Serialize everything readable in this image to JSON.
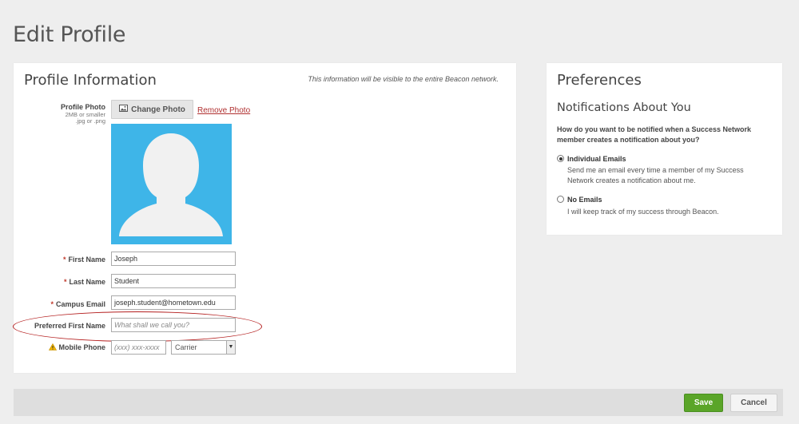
{
  "page": {
    "title": "Edit Profile"
  },
  "profile": {
    "heading": "Profile Information",
    "visibility_note": "This information will be visible to the entire Beacon network.",
    "photo": {
      "label": "Profile Photo",
      "hint_size": "2MB or smaller",
      "hint_type": ".jpg or .png",
      "change_label": "Change Photo",
      "remove_label": "Remove Photo"
    },
    "fields": {
      "first_name": {
        "label": "First Name",
        "value": "Joseph",
        "required": "*"
      },
      "last_name": {
        "label": "Last Name",
        "value": "Student",
        "required": "*"
      },
      "campus_email": {
        "label": "Campus Email",
        "value": "joseph.student@hometown.edu",
        "required": "*"
      },
      "preferred_first_name": {
        "label": "Preferred First Name",
        "placeholder": "What shall we call you?"
      },
      "mobile_phone": {
        "label": "Mobile Phone",
        "placeholder": "(xxx) xxx-xxxx",
        "carrier": "Carrier"
      }
    }
  },
  "preferences": {
    "heading": "Preferences",
    "subheading": "Notifications About You",
    "question": "How do you want to be notified when a Success Network member creates a notification about you?",
    "options": [
      {
        "title": "Individual Emails",
        "description": "Send me an email every time a member of my Success Network creates a notification about me.",
        "selected": true
      },
      {
        "title": "No Emails",
        "description": "I will keep track of my success through Beacon.",
        "selected": false
      }
    ]
  },
  "footer": {
    "save_label": "Save",
    "cancel_label": "Cancel"
  },
  "colors": {
    "accent_green": "#5aa528",
    "avatar_blue": "#3eb5e8",
    "required_red": "#c0392b",
    "highlight_red": "#b41e1e",
    "warning_yellow": "#f0b400"
  },
  "icons": {
    "photo_button": "image-icon",
    "mobile_warning": "warning-icon",
    "avatar": "person-silhouette-icon",
    "carrier_dropdown": "chevron-down-icon"
  }
}
